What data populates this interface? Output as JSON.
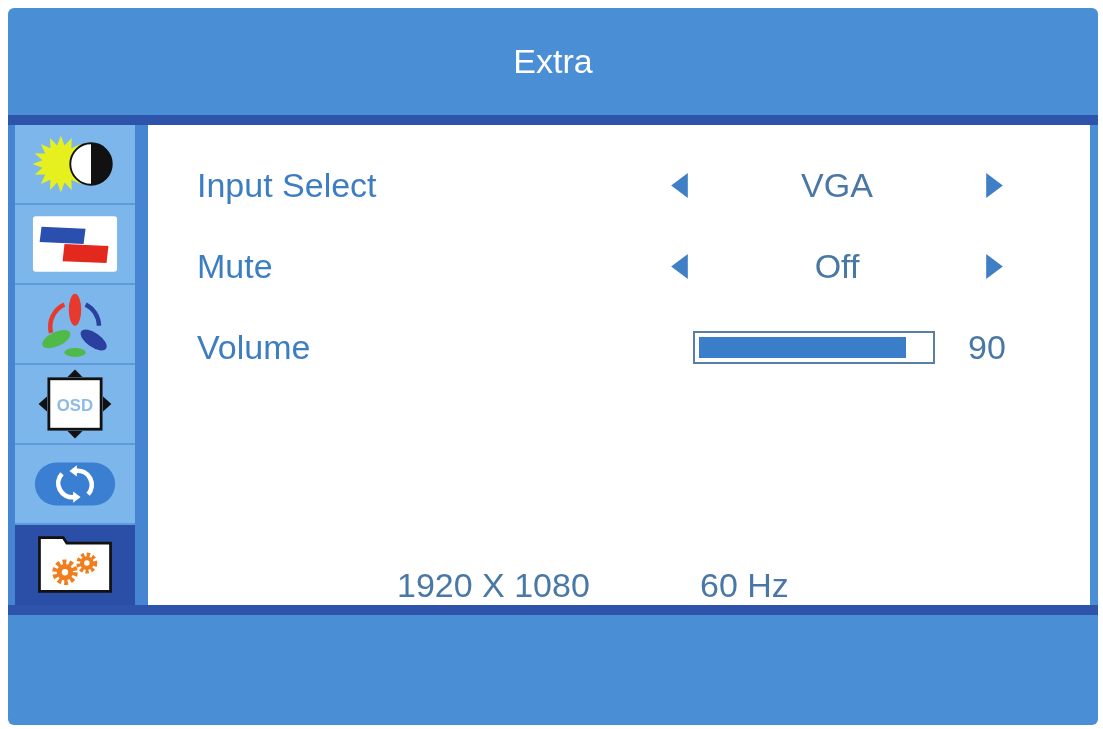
{
  "title": "Extra",
  "sidebar": {
    "items": [
      {
        "kind": "brightness",
        "selected": false
      },
      {
        "kind": "image",
        "selected": false
      },
      {
        "kind": "color",
        "selected": false
      },
      {
        "kind": "osd",
        "label": "OSD",
        "selected": false
      },
      {
        "kind": "reset",
        "selected": false
      },
      {
        "kind": "extra",
        "selected": true
      }
    ]
  },
  "menu": {
    "rows": [
      {
        "kind": "option",
        "label": "Input Select",
        "value": "VGA"
      },
      {
        "kind": "option",
        "label": "Mute",
        "value": "Off"
      },
      {
        "kind": "slider",
        "label": "Volume",
        "level": 0.9,
        "reading": "90"
      }
    ]
  },
  "status": {
    "resolution": "1920 X 1080",
    "refresh_rate": "60 Hz"
  }
}
